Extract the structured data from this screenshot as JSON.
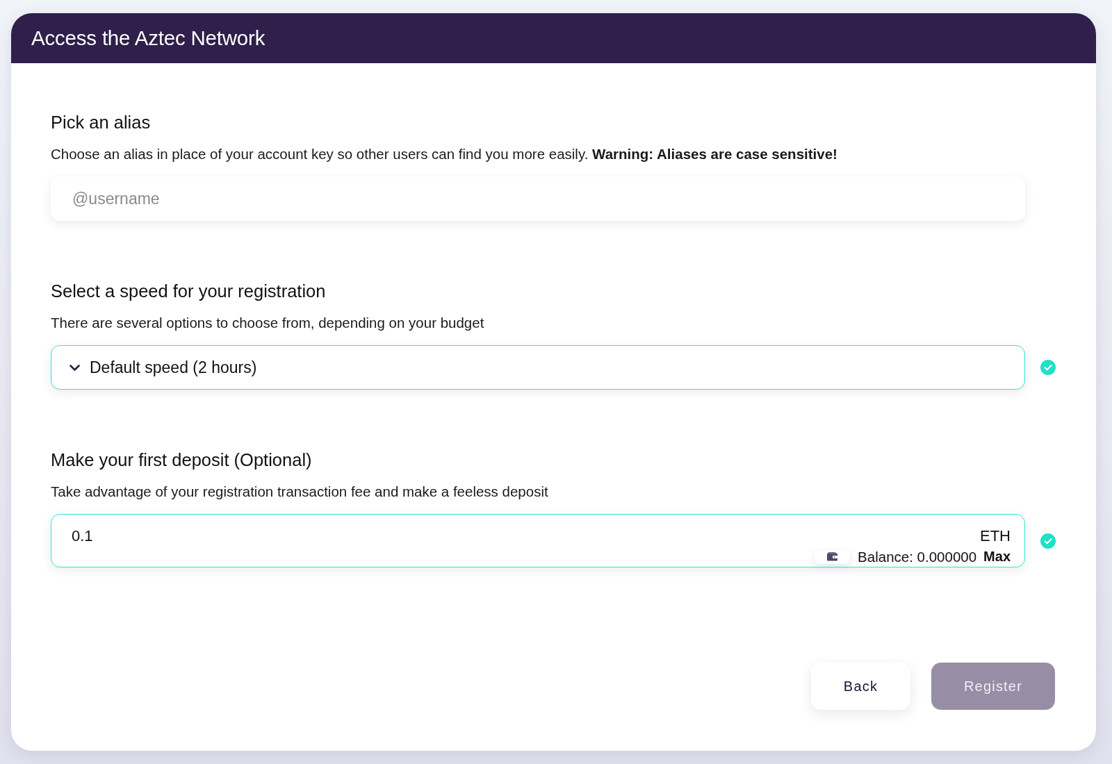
{
  "header": {
    "title": "Access the Aztec Network"
  },
  "sections": [
    {
      "kind": "text",
      "heading": "Pick an alias",
      "description": "Choose an alias in place of your account key so other users can find you more easily. **Warning: Aliases are case sensitive!**",
      "placeholder": "@username",
      "valid": false
    },
    {
      "kind": "select",
      "heading": "Select a speed for your registration",
      "description": "There are several options to choose from, depending on your budget",
      "value": "Default speed (2 hours)",
      "valid": true
    },
    {
      "kind": "amount",
      "heading": "Make your first deposit (Optional)",
      "description": "Take advantage of your registration transaction fee and make a feeless deposit",
      "value": "0.1",
      "currency": "ETH",
      "balance": "Balance: 0.000000",
      "max": "Max",
      "valid": true
    }
  ],
  "buttons": [
    {
      "label": "Back",
      "kind": "secondary",
      "disabled": false
    },
    {
      "label": "Register",
      "kind": "primary",
      "disabled": true
    }
  ]
}
